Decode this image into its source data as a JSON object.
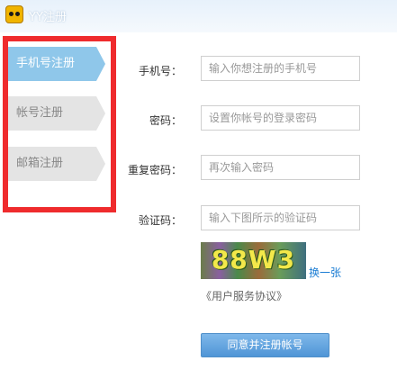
{
  "window": {
    "title": "YY注册"
  },
  "nav": {
    "items": [
      {
        "label": "手机号注册",
        "active": true
      },
      {
        "label": "帐号注册",
        "active": false
      },
      {
        "label": "邮箱注册",
        "active": false
      }
    ],
    "highlight_color": "#ef2b2d",
    "active_color": "#8fc7ea"
  },
  "form": {
    "phone": {
      "label": "手机号：",
      "placeholder": "输入你想注册的手机号"
    },
    "password": {
      "label": "密码：",
      "placeholder": "设置你帐号的登录密码"
    },
    "confirm": {
      "label": "重复密码：",
      "placeholder": "再次输入密码"
    },
    "captcha": {
      "label": "验证码：",
      "placeholder": "输入下图所示的验证码",
      "image_text": "88W3",
      "refresh_label": "换一张"
    },
    "agreement_label": "《用户服务协议》",
    "submit_label": "同意并注册帐号"
  }
}
